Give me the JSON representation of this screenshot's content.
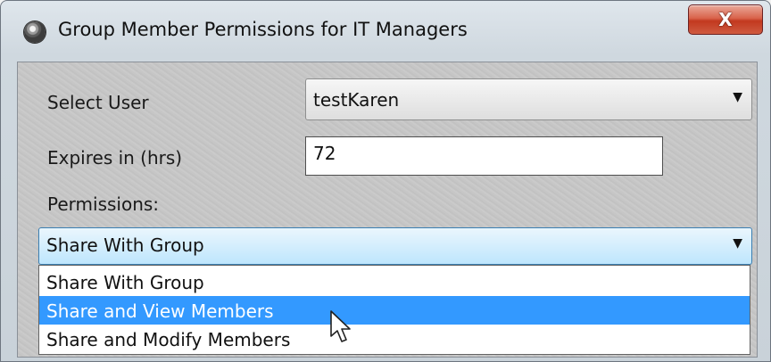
{
  "window": {
    "title": "Group Member Permissions for IT Managers",
    "close_label": "X"
  },
  "form": {
    "select_user": {
      "label": "Select User",
      "value": "testKaren"
    },
    "expires": {
      "label": "Expires in (hrs)",
      "value": "72"
    },
    "permissions": {
      "label": "Permissions:",
      "value": "Share With Group",
      "options": [
        "Share With Group",
        "Share and View Members",
        "Share and Modify Members"
      ],
      "highlighted_option": "Share and View Members"
    }
  },
  "icons": {
    "app": "app-icon",
    "close": "close-icon",
    "dropdown_arrow": "chevron-down-icon",
    "cursor": "mouse-pointer-icon"
  },
  "colors": {
    "selection": "#3399ff",
    "close_button": "#c2391f",
    "focused_combo": "#bee6fd"
  }
}
